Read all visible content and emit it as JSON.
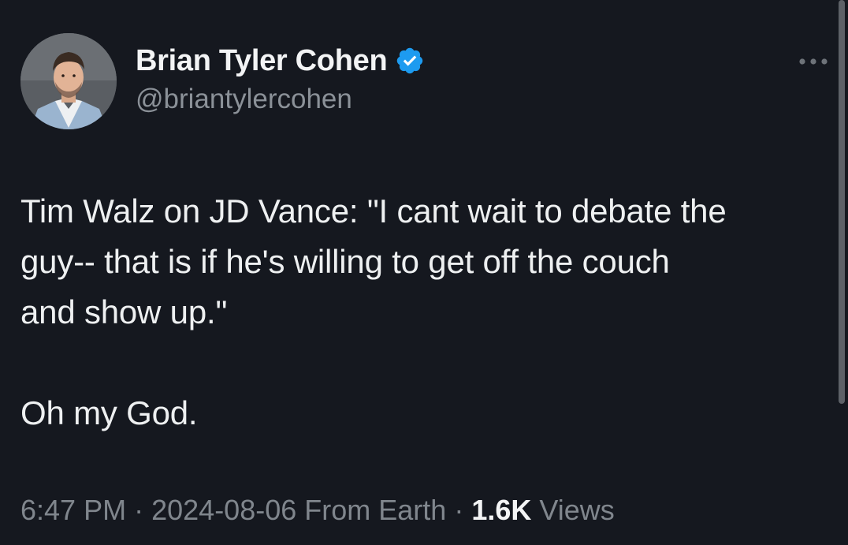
{
  "author": {
    "display_name": "Brian Tyler Cohen",
    "handle": "@briantylercohen",
    "verified": true
  },
  "tweet": {
    "paragraph_1": "Tim Walz on JD Vance: \"I cant wait to debate the\nguy-- that is if he's willing to get off the couch\nand show up.\"",
    "paragraph_2": "Oh my God."
  },
  "meta": {
    "time": "6:47 PM",
    "separator": "·",
    "date": "2024-08-06",
    "source": "From Earth",
    "views_count": "1.6K",
    "views_label": "Views"
  },
  "icons": {
    "verified": "verified-badge-icon",
    "more": "more-options-icon"
  },
  "colors": {
    "background": "#15181f",
    "verified_blue": "#1d9bf0",
    "secondary_text": "#80868d"
  }
}
